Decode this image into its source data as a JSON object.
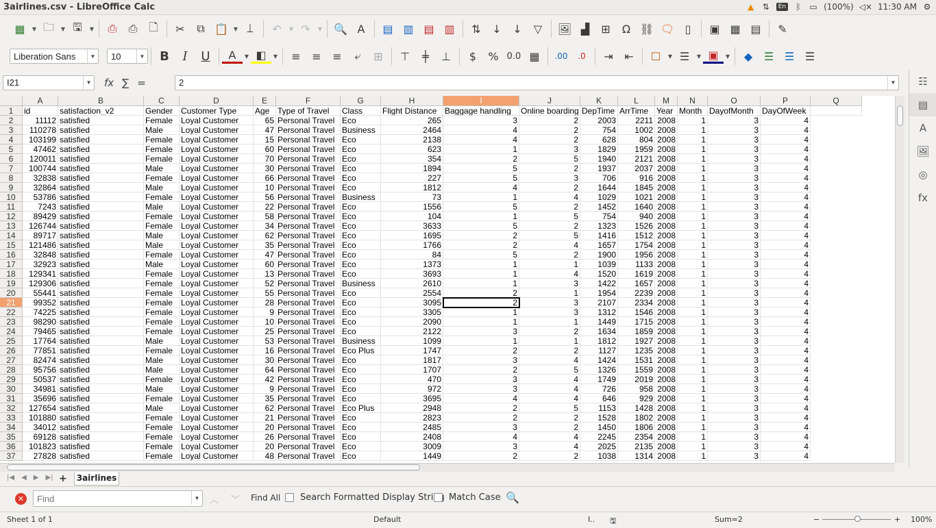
{
  "window": {
    "title": "3airlines.csv - LibreOffice Calc"
  },
  "tray": {
    "keyboard": "En",
    "battery": "(100%)",
    "clock": "11:30 AM"
  },
  "toolbar2": {
    "font_name": "Liberation Sans",
    "font_size": "10"
  },
  "formula_bar": {
    "cell_ref": "I21",
    "content": "2"
  },
  "columns": [
    "A",
    "B",
    "C",
    "D",
    "E",
    "F",
    "G",
    "H",
    "I",
    "J",
    "K",
    "L",
    "M",
    "N",
    "O",
    "P",
    "Q"
  ],
  "selected_column": "I",
  "selected_row": 21,
  "header_row": [
    "id",
    "satisfaction_v2",
    "Gender",
    "Customer Type",
    "Age",
    "Type of Travel",
    "Class",
    "Flight Distance",
    "Baggage handling",
    "Online boarding",
    "DepTime",
    "ArrTime",
    "Year",
    "Month",
    "DayofMonth",
    "DayOfWeek",
    ""
  ],
  "rows": [
    [
      "11112",
      "satisfied",
      "Female",
      "Loyal Customer",
      "65",
      "Personal Travel",
      "Eco",
      "265",
      "3",
      "2",
      "2003",
      "2211",
      "2008",
      "1",
      "3",
      "4"
    ],
    [
      "110278",
      "satisfied",
      "Male",
      "Loyal Customer",
      "47",
      "Personal Travel",
      "Business",
      "2464",
      "4",
      "2",
      "754",
      "1002",
      "2008",
      "1",
      "3",
      "4"
    ],
    [
      "103199",
      "satisfied",
      "Female",
      "Loyal Customer",
      "15",
      "Personal Travel",
      "Eco",
      "2138",
      "4",
      "2",
      "628",
      "804",
      "2008",
      "1",
      "3",
      "4"
    ],
    [
      "47462",
      "satisfied",
      "Female",
      "Loyal Customer",
      "60",
      "Personal Travel",
      "Eco",
      "623",
      "1",
      "3",
      "1829",
      "1959",
      "2008",
      "1",
      "3",
      "4"
    ],
    [
      "120011",
      "satisfied",
      "Female",
      "Loyal Customer",
      "70",
      "Personal Travel",
      "Eco",
      "354",
      "2",
      "5",
      "1940",
      "2121",
      "2008",
      "1",
      "3",
      "4"
    ],
    [
      "100744",
      "satisfied",
      "Male",
      "Loyal Customer",
      "30",
      "Personal Travel",
      "Eco",
      "1894",
      "5",
      "2",
      "1937",
      "2037",
      "2008",
      "1",
      "3",
      "4"
    ],
    [
      "32838",
      "satisfied",
      "Female",
      "Loyal Customer",
      "66",
      "Personal Travel",
      "Eco",
      "227",
      "5",
      "3",
      "706",
      "916",
      "2008",
      "1",
      "3",
      "4"
    ],
    [
      "32864",
      "satisfied",
      "Male",
      "Loyal Customer",
      "10",
      "Personal Travel",
      "Eco",
      "1812",
      "4",
      "2",
      "1644",
      "1845",
      "2008",
      "1",
      "3",
      "4"
    ],
    [
      "53786",
      "satisfied",
      "Female",
      "Loyal Customer",
      "56",
      "Personal Travel",
      "Business",
      "73",
      "1",
      "4",
      "1029",
      "1021",
      "2008",
      "1",
      "3",
      "4"
    ],
    [
      "7243",
      "satisfied",
      "Male",
      "Loyal Customer",
      "22",
      "Personal Travel",
      "Eco",
      "1556",
      "5",
      "2",
      "1452",
      "1640",
      "2008",
      "1",
      "3",
      "4"
    ],
    [
      "89429",
      "satisfied",
      "Female",
      "Loyal Customer",
      "58",
      "Personal Travel",
      "Eco",
      "104",
      "1",
      "5",
      "754",
      "940",
      "2008",
      "1",
      "3",
      "4"
    ],
    [
      "126744",
      "satisfied",
      "Female",
      "Loyal Customer",
      "34",
      "Personal Travel",
      "Eco",
      "3633",
      "5",
      "2",
      "1323",
      "1526",
      "2008",
      "1",
      "3",
      "4"
    ],
    [
      "89717",
      "satisfied",
      "Male",
      "Loyal Customer",
      "62",
      "Personal Travel",
      "Eco",
      "1695",
      "2",
      "5",
      "1416",
      "1512",
      "2008",
      "1",
      "3",
      "4"
    ],
    [
      "121486",
      "satisfied",
      "Male",
      "Loyal Customer",
      "35",
      "Personal Travel",
      "Eco",
      "1766",
      "2",
      "4",
      "1657",
      "1754",
      "2008",
      "1",
      "3",
      "4"
    ],
    [
      "32848",
      "satisfied",
      "Female",
      "Loyal Customer",
      "47",
      "Personal Travel",
      "Eco",
      "84",
      "5",
      "2",
      "1900",
      "1956",
      "2008",
      "1",
      "3",
      "4"
    ],
    [
      "32923",
      "satisfied",
      "Male",
      "Loyal Customer",
      "60",
      "Personal Travel",
      "Eco",
      "1373",
      "1",
      "1",
      "1039",
      "1133",
      "2008",
      "1",
      "3",
      "4"
    ],
    [
      "129341",
      "satisfied",
      "Female",
      "Loyal Customer",
      "13",
      "Personal Travel",
      "Eco",
      "3693",
      "1",
      "4",
      "1520",
      "1619",
      "2008",
      "1",
      "3",
      "4"
    ],
    [
      "129306",
      "satisfied",
      "Female",
      "Loyal Customer",
      "52",
      "Personal Travel",
      "Business",
      "2610",
      "1",
      "3",
      "1422",
      "1657",
      "2008",
      "1",
      "3",
      "4"
    ],
    [
      "55441",
      "satisfied",
      "Female",
      "Loyal Customer",
      "55",
      "Personal Travel",
      "Eco",
      "2554",
      "2",
      "1",
      "1954",
      "2239",
      "2008",
      "1",
      "3",
      "4"
    ],
    [
      "99352",
      "satisfied",
      "Female",
      "Loyal Customer",
      "28",
      "Personal Travel",
      "Eco",
      "3095",
      "2",
      "3",
      "2107",
      "2334",
      "2008",
      "1",
      "3",
      "4"
    ],
    [
      "74225",
      "satisfied",
      "Female",
      "Loyal Customer",
      "9",
      "Personal Travel",
      "Eco",
      "3305",
      "1",
      "3",
      "1312",
      "1546",
      "2008",
      "1",
      "3",
      "4"
    ],
    [
      "98290",
      "satisfied",
      "Female",
      "Loyal Customer",
      "10",
      "Personal Travel",
      "Eco",
      "2090",
      "1",
      "1",
      "1449",
      "1715",
      "2008",
      "1",
      "3",
      "4"
    ],
    [
      "79465",
      "satisfied",
      "Female",
      "Loyal Customer",
      "25",
      "Personal Travel",
      "Eco",
      "2122",
      "3",
      "2",
      "1634",
      "1859",
      "2008",
      "1",
      "3",
      "4"
    ],
    [
      "17764",
      "satisfied",
      "Male",
      "Loyal Customer",
      "53",
      "Personal Travel",
      "Business",
      "1099",
      "1",
      "1",
      "1812",
      "1927",
      "2008",
      "1",
      "3",
      "4"
    ],
    [
      "77851",
      "satisfied",
      "Female",
      "Loyal Customer",
      "16",
      "Personal Travel",
      "Eco Plus",
      "1747",
      "2",
      "2",
      "1127",
      "1235",
      "2008",
      "1",
      "3",
      "4"
    ],
    [
      "82474",
      "satisfied",
      "Male",
      "Loyal Customer",
      "30",
      "Personal Travel",
      "Eco",
      "1817",
      "3",
      "4",
      "1424",
      "1531",
      "2008",
      "1",
      "3",
      "4"
    ],
    [
      "95756",
      "satisfied",
      "Male",
      "Loyal Customer",
      "64",
      "Personal Travel",
      "Eco",
      "1707",
      "2",
      "5",
      "1326",
      "1559",
      "2008",
      "1",
      "3",
      "4"
    ],
    [
      "50537",
      "satisfied",
      "Female",
      "Loyal Customer",
      "42",
      "Personal Travel",
      "Eco",
      "470",
      "3",
      "4",
      "1749",
      "2019",
      "2008",
      "1",
      "3",
      "4"
    ],
    [
      "34981",
      "satisfied",
      "Male",
      "Loyal Customer",
      "9",
      "Personal Travel",
      "Eco",
      "972",
      "3",
      "4",
      "726",
      "958",
      "2008",
      "1",
      "3",
      "4"
    ],
    [
      "35696",
      "satisfied",
      "Female",
      "Loyal Customer",
      "35",
      "Personal Travel",
      "Eco",
      "3695",
      "4",
      "4",
      "646",
      "929",
      "2008",
      "1",
      "3",
      "4"
    ],
    [
      "127654",
      "satisfied",
      "Male",
      "Loyal Customer",
      "62",
      "Personal Travel",
      "Eco Plus",
      "2948",
      "2",
      "5",
      "1153",
      "1428",
      "2008",
      "1",
      "3",
      "4"
    ],
    [
      "101880",
      "satisfied",
      "Female",
      "Loyal Customer",
      "21",
      "Personal Travel",
      "Eco",
      "2823",
      "2",
      "2",
      "1528",
      "1802",
      "2008",
      "1",
      "3",
      "4"
    ],
    [
      "34012",
      "satisfied",
      "Female",
      "Loyal Customer",
      "20",
      "Personal Travel",
      "Eco",
      "2485",
      "3",
      "2",
      "1450",
      "1806",
      "2008",
      "1",
      "3",
      "4"
    ],
    [
      "69128",
      "satisfied",
      "Female",
      "Loyal Customer",
      "26",
      "Personal Travel",
      "Eco",
      "2408",
      "4",
      "4",
      "2245",
      "2354",
      "2008",
      "1",
      "3",
      "4"
    ],
    [
      "101823",
      "satisfied",
      "Female",
      "Loyal Customer",
      "20",
      "Personal Travel",
      "Eco",
      "3009",
      "3",
      "4",
      "2025",
      "2135",
      "2008",
      "1",
      "3",
      "4"
    ],
    [
      "27828",
      "satisfied",
      "Female",
      "Loyal Customer",
      "48",
      "Personal Travel",
      "Eco",
      "1449",
      "2",
      "2",
      "1038",
      "1314",
      "2008",
      "1",
      "3",
      "4"
    ]
  ],
  "sheet_tabs": [
    "3airlines"
  ],
  "findbar": {
    "placeholder": "Find",
    "find_all": "Find All",
    "formatted_label": "Search Formatted Display String",
    "match_case_label": "Match Case"
  },
  "status": {
    "sheet": "Sheet 1 of 1",
    "style": "Default",
    "sum": "Sum=2",
    "zoom": "100%"
  }
}
